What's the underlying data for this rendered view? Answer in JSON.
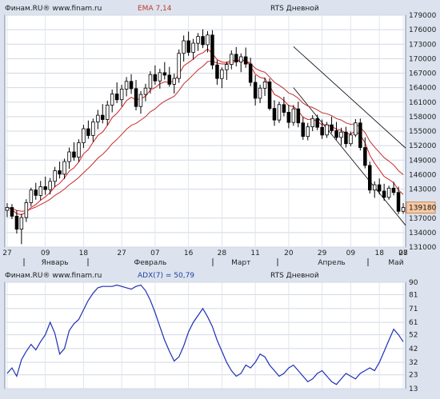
{
  "top": {
    "source": "Финам.RU® www.finam.ru",
    "indicator": "EMA 7,14",
    "title": "RTS Дневной"
  },
  "bottom": {
    "source": "Финам.RU® www.finam.ru",
    "indicator": "ADX(7) = 50,79",
    "title": "RTS Дневной"
  },
  "colors": {
    "candle_up": "#ffffff",
    "candle_down": "#000000",
    "ema_fast": "#d42020",
    "ema_slow": "#c23030",
    "adx_line": "#1f2fb5",
    "channel": "#000000",
    "last_price_bg": "#f7c9a5"
  },
  "chart_data": [
    {
      "type": "candlestick",
      "title": "RTS Дневной",
      "indicator": "EMA 7,14",
      "ylim": [
        131000,
        179000
      ],
      "y_ticks": [
        131000,
        134000,
        137000,
        139180,
        143000,
        146000,
        149000,
        152000,
        155000,
        158000,
        161000,
        164000,
        167000,
        170000,
        173000,
        176000,
        179000
      ],
      "last_price": 139180,
      "x_day_labels": [
        "27",
        "09",
        "18",
        "27",
        "07",
        "16",
        "28",
        "11",
        "20",
        "29",
        "09",
        "18",
        "27",
        "08"
      ],
      "x_month_labels": [
        "Январь",
        "Февраль",
        "Март",
        "Апрель",
        "Май"
      ],
      "ohlc": [
        [
          138600,
          140100,
          137200,
          139200
        ],
        [
          139200,
          139900,
          136800,
          137400
        ],
        [
          137400,
          138600,
          133800,
          134700
        ],
        [
          134700,
          137900,
          131600,
          137100
        ],
        [
          137100,
          140900,
          136200,
          140200
        ],
        [
          140200,
          143300,
          139400,
          142800
        ],
        [
          142800,
          144300,
          140800,
          141700
        ],
        [
          141700,
          144700,
          140700,
          143500
        ],
        [
          143500,
          145600,
          141800,
          142900
        ],
        [
          142900,
          145300,
          141900,
          144600
        ],
        [
          144600,
          147600,
          143400,
          146800
        ],
        [
          146800,
          148700,
          145200,
          146100
        ],
        [
          146100,
          149300,
          145100,
          148700
        ],
        [
          148700,
          151600,
          147200,
          150700
        ],
        [
          150700,
          152700,
          148900,
          149600
        ],
        [
          149600,
          153300,
          148600,
          152600
        ],
        [
          152600,
          156300,
          151500,
          155500
        ],
        [
          155500,
          157200,
          153400,
          154100
        ],
        [
          154100,
          157600,
          152800,
          156900
        ],
        [
          156900,
          159400,
          155400,
          158300
        ],
        [
          158300,
          160600,
          156600,
          157400
        ],
        [
          157400,
          161300,
          156200,
          160400
        ],
        [
          160400,
          163600,
          158900,
          162700
        ],
        [
          162700,
          165100,
          160800,
          161500
        ],
        [
          161500,
          164600,
          160100,
          163700
        ],
        [
          163700,
          166200,
          162200,
          165300
        ],
        [
          165300,
          166800,
          162700,
          163800
        ],
        [
          163800,
          165600,
          159300,
          160100
        ],
        [
          160100,
          163300,
          158600,
          162600
        ],
        [
          162600,
          164800,
          161200,
          163900
        ],
        [
          163900,
          167400,
          162800,
          166700
        ],
        [
          166700,
          168600,
          164600,
          165400
        ],
        [
          165400,
          167900,
          163800,
          167100
        ],
        [
          167100,
          169300,
          165700,
          166600
        ],
        [
          166600,
          168300,
          164200,
          164700
        ],
        [
          164700,
          166900,
          162800,
          165900
        ],
        [
          165900,
          171900,
          165000,
          171100
        ],
        [
          171100,
          174800,
          169400,
          173700
        ],
        [
          173700,
          175600,
          170600,
          171300
        ],
        [
          171300,
          174100,
          169800,
          173200
        ],
        [
          173200,
          175300,
          171600,
          174600
        ],
        [
          174600,
          176100,
          172200,
          172900
        ],
        [
          172900,
          175700,
          171300,
          174900
        ],
        [
          174900,
          175900,
          167800,
          168700
        ],
        [
          168700,
          169700,
          164600,
          165900
        ],
        [
          165900,
          168200,
          163900,
          167700
        ],
        [
          167700,
          169400,
          165600,
          168800
        ],
        [
          168800,
          171700,
          167800,
          170900
        ],
        [
          170900,
          172400,
          168400,
          169300
        ],
        [
          169300,
          171100,
          167200,
          170400
        ],
        [
          170400,
          172300,
          168100,
          168900
        ],
        [
          168900,
          170200,
          164300,
          165100
        ],
        [
          165100,
          166600,
          160300,
          161800
        ],
        [
          161800,
          164600,
          160800,
          163900
        ],
        [
          163900,
          166100,
          162300,
          165200
        ],
        [
          165200,
          165900,
          159300,
          159700
        ],
        [
          159700,
          161400,
          156100,
          157300
        ],
        [
          157300,
          161100,
          156700,
          160500
        ],
        [
          160500,
          162100,
          158100,
          158900
        ],
        [
          158900,
          160400,
          155600,
          156800
        ],
        [
          156800,
          160400,
          156100,
          159600
        ],
        [
          159600,
          161100,
          155800,
          156700
        ],
        [
          156700,
          157900,
          153200,
          153900
        ],
        [
          153900,
          156700,
          153100,
          155900
        ],
        [
          155900,
          158300,
          155000,
          157600
        ],
        [
          157600,
          158400,
          155200,
          155800
        ],
        [
          155800,
          157400,
          153400,
          154200
        ],
        [
          154200,
          156900,
          153600,
          156300
        ],
        [
          156300,
          158000,
          154600,
          155100
        ],
        [
          155100,
          156900,
          153200,
          153700
        ],
        [
          153700,
          155700,
          152100,
          154800
        ],
        [
          154800,
          155900,
          151600,
          152400
        ],
        [
          152400,
          154900,
          151900,
          154200
        ],
        [
          154200,
          157500,
          153800,
          156700
        ],
        [
          156700,
          157600,
          151000,
          151600
        ],
        [
          151600,
          153700,
          147300,
          147900
        ],
        [
          147900,
          148700,
          142100,
          142800
        ],
        [
          142800,
          144600,
          141200,
          143900
        ],
        [
          143900,
          145200,
          141900,
          142600
        ],
        [
          142600,
          144100,
          140600,
          141300
        ],
        [
          141300,
          143700,
          140800,
          143200
        ],
        [
          143200,
          144500,
          141700,
          142300
        ],
        [
          142300,
          143500,
          137800,
          138400
        ],
        [
          138400,
          140100,
          137900,
          139180
        ]
      ],
      "ema7": [
        139200,
        138800,
        137900,
        137700,
        138200,
        139200,
        139800,
        140700,
        141400,
        142300,
        143500,
        144200,
        145300,
        146700,
        147400,
        148600,
        150300,
        151200,
        152700,
        154100,
        154800,
        156200,
        157800,
        158700,
        159900,
        161300,
        162000,
        161500,
        161700,
        162200,
        163500,
        164000,
        164800,
        165200,
        165100,
        165400,
        166800,
        168500,
        169200,
        169900,
        170800,
        171200,
        172000,
        171100,
        169800,
        169300,
        169200,
        169700,
        169600,
        169800,
        169600,
        168500,
        166800,
        166100,
        165900,
        164400,
        162600,
        162100,
        161300,
        160300,
        160100,
        159200,
        157900,
        157400,
        157500,
        157000,
        156300,
        156300,
        156000,
        155400,
        155200,
        154500,
        154400,
        155000,
        154200,
        152600,
        150000,
        148400,
        147000,
        145600,
        145000,
        144300,
        142800,
        141900
      ],
      "ema14": [
        139200,
        139000,
        138600,
        138400,
        138500,
        138900,
        139300,
        139800,
        140300,
        140900,
        141700,
        142300,
        143000,
        143900,
        144600,
        145400,
        146400,
        147300,
        148300,
        149400,
        150200,
        151200,
        152400,
        153300,
        154300,
        155400,
        156200,
        156600,
        157300,
        158000,
        159000,
        159600,
        160500,
        161200,
        161700,
        162200,
        163400,
        164800,
        165700,
        166700,
        167700,
        168400,
        169400,
        169500,
        169100,
        168900,
        168900,
        169300,
        169400,
        169600,
        169600,
        169000,
        168000,
        167500,
        167200,
        166200,
        165100,
        164500,
        163800,
        162900,
        162500,
        161800,
        160800,
        160200,
        159900,
        159400,
        158800,
        158600,
        158200,
        157600,
        157300,
        156700,
        156400,
        156500,
        155800,
        154700,
        152900,
        151700,
        150600,
        149500,
        148800,
        148000,
        146800,
        146000
      ]
    },
    {
      "type": "line",
      "title": "RTS Дневной",
      "series_name": "ADX(7)",
      "last_value": 50.79,
      "ylim": [
        13,
        90
      ],
      "y_ticks": [
        13,
        23,
        32,
        42,
        52,
        61,
        71,
        81,
        90
      ],
      "values": [
        24,
        28,
        22,
        34,
        40,
        45,
        41,
        47,
        52,
        61,
        53,
        38,
        42,
        55,
        60,
        63,
        70,
        77,
        82,
        86,
        87,
        87,
        87,
        88,
        87,
        86,
        85,
        87,
        88,
        84,
        77,
        68,
        58,
        48,
        40,
        33,
        36,
        44,
        54,
        61,
        66,
        71,
        65,
        58,
        48,
        40,
        32,
        26,
        22,
        24,
        30,
        28,
        32,
        38,
        36,
        30,
        26,
        22,
        24,
        28,
        30,
        26,
        22,
        18,
        20,
        24,
        26,
        22,
        18,
        16,
        20,
        24,
        22,
        20,
        24,
        26,
        28,
        26,
        32,
        40,
        48,
        56,
        52,
        47
      ]
    }
  ]
}
